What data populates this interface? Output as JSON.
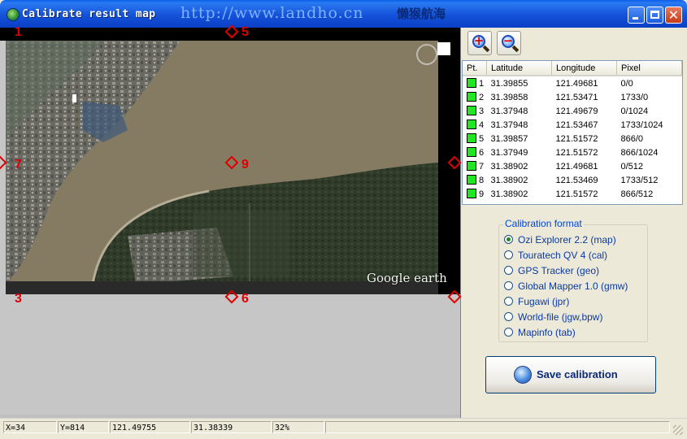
{
  "window": {
    "title": "Calibrate result map",
    "url_text": "http://www.landho.cn",
    "brand_text": "懒猴航海",
    "controls": {
      "minimize": "minimize",
      "maximize": "maximize",
      "close": "✕"
    }
  },
  "map": {
    "markers": [
      "1",
      "5",
      "7",
      "9",
      "3",
      "6"
    ],
    "watermark": "Google earth"
  },
  "toolbar": {
    "zoom_in": "+",
    "zoom_out": "−"
  },
  "table": {
    "headers": [
      "Pt.",
      "Latitude",
      "Longitude",
      "Pixel"
    ],
    "rows": [
      {
        "pt": "1",
        "lat": "31.39855",
        "lon": "121.49681",
        "pixel": "0/0"
      },
      {
        "pt": "2",
        "lat": "31.39858",
        "lon": "121.53471",
        "pixel": "1733/0"
      },
      {
        "pt": "3",
        "lat": "31.37948",
        "lon": "121.49679",
        "pixel": "0/1024"
      },
      {
        "pt": "4",
        "lat": "31.37948",
        "lon": "121.53467",
        "pixel": "1733/1024"
      },
      {
        "pt": "5",
        "lat": "31.39857",
        "lon": "121.51572",
        "pixel": "866/0"
      },
      {
        "pt": "6",
        "lat": "31.37949",
        "lon": "121.51572",
        "pixel": "866/1024"
      },
      {
        "pt": "7",
        "lat": "31.38902",
        "lon": "121.49681",
        "pixel": "0/512"
      },
      {
        "pt": "8",
        "lat": "31.38902",
        "lon": "121.53469",
        "pixel": "1733/512"
      },
      {
        "pt": "9",
        "lat": "31.38902",
        "lon": "121.51572",
        "pixel": "866/512"
      }
    ]
  },
  "calibration": {
    "legend": "Calibration format",
    "options": [
      "Ozi Explorer 2.2 (map)",
      "Touratech QV 4 (cal)",
      "GPS Tracker (geo)",
      "Global Mapper 1.0 (gmw)",
      "Fugawi (jpr)",
      "World-file (jgw,bpw)",
      "Mapinfo (tab)"
    ],
    "selected_index": 0
  },
  "save_button": "Save calibration",
  "status": {
    "x": "X=34",
    "y": "Y=814",
    "lon": "121.49755",
    "lat": "31.38339",
    "zoom": "32%",
    "extra": ""
  },
  "colors": {
    "marker": "#e00000",
    "chip": "#22e622",
    "title_bar": "#0a5fe8"
  }
}
